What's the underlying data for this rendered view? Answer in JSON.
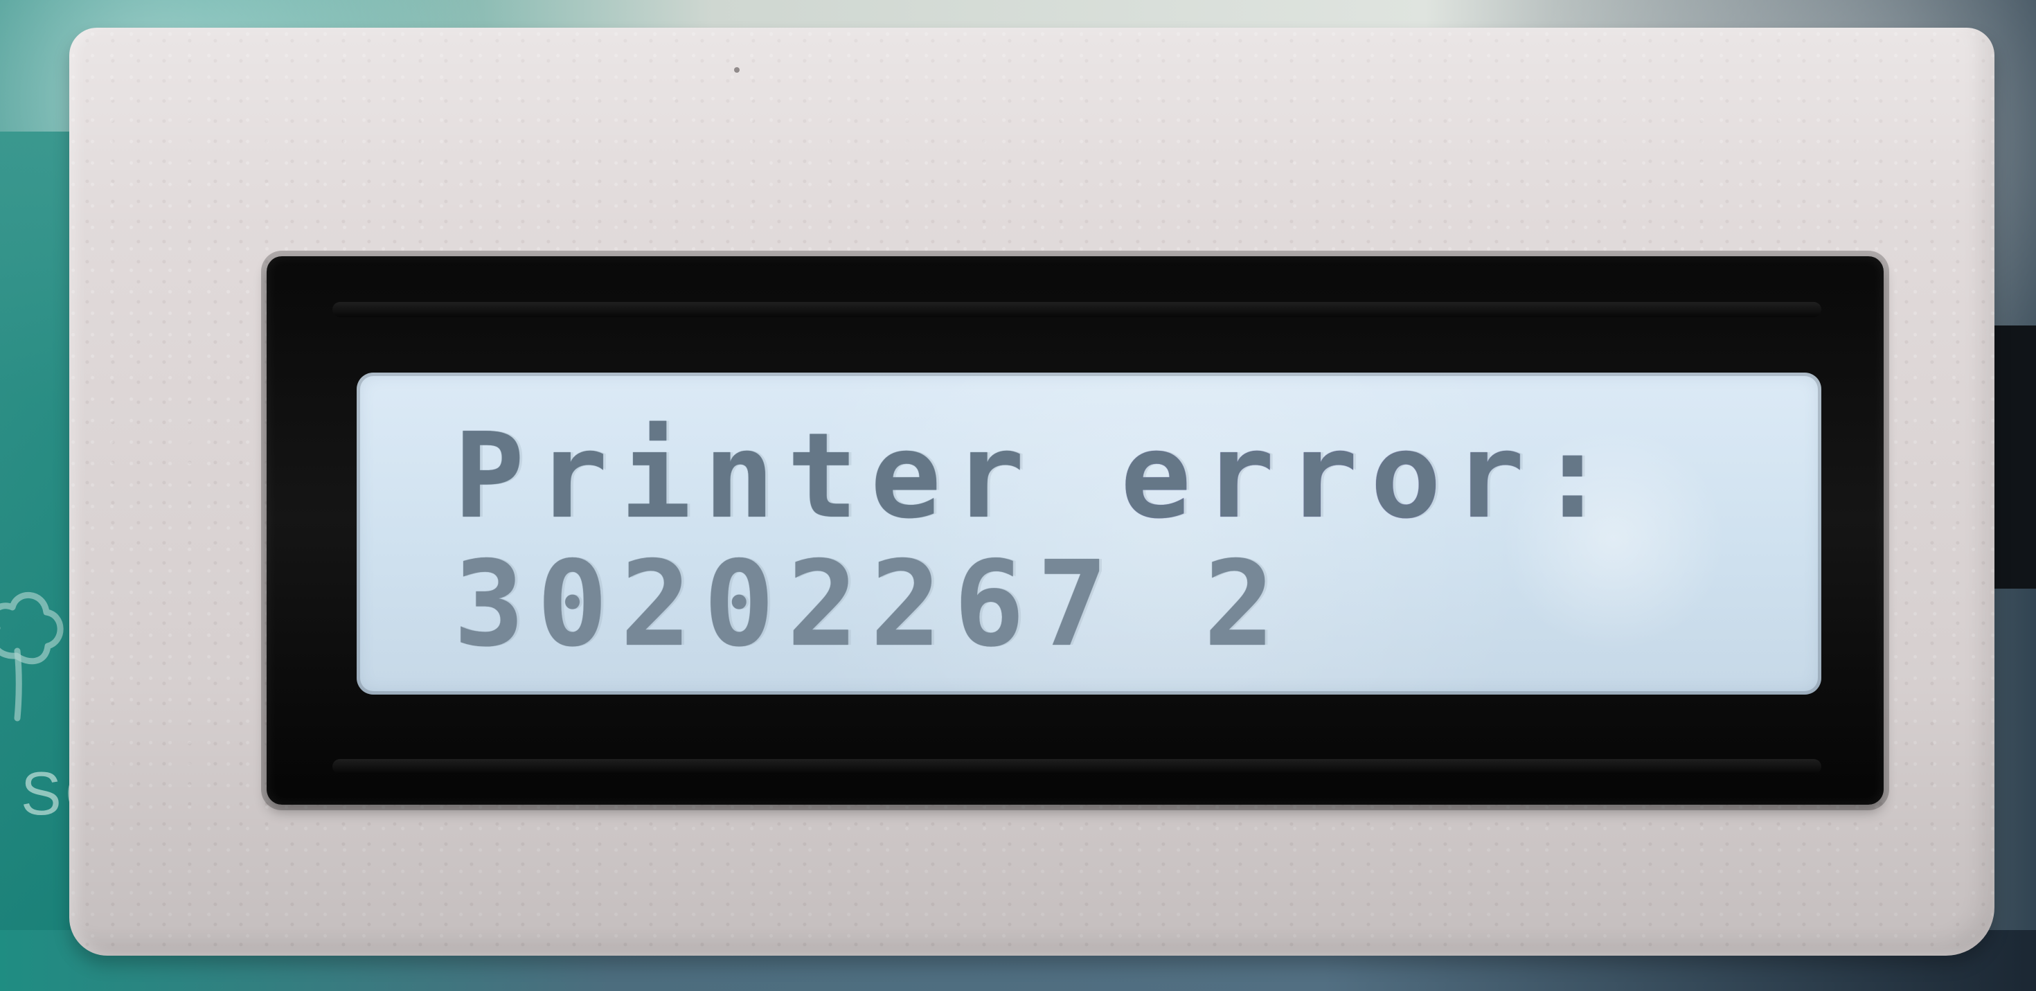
{
  "lcd": {
    "line1": "Printer error:",
    "line2": "30202267 2"
  },
  "background_marks": {
    "left_logo_text": "SC"
  },
  "colors": {
    "enclosure": "#dfd8d8",
    "bezel": "#111111",
    "lcd_background": "#cfe1ef",
    "lcd_text": "#778897",
    "accent_text": "#755bb8"
  },
  "icons": {
    "left_logo": "tree-icon"
  }
}
